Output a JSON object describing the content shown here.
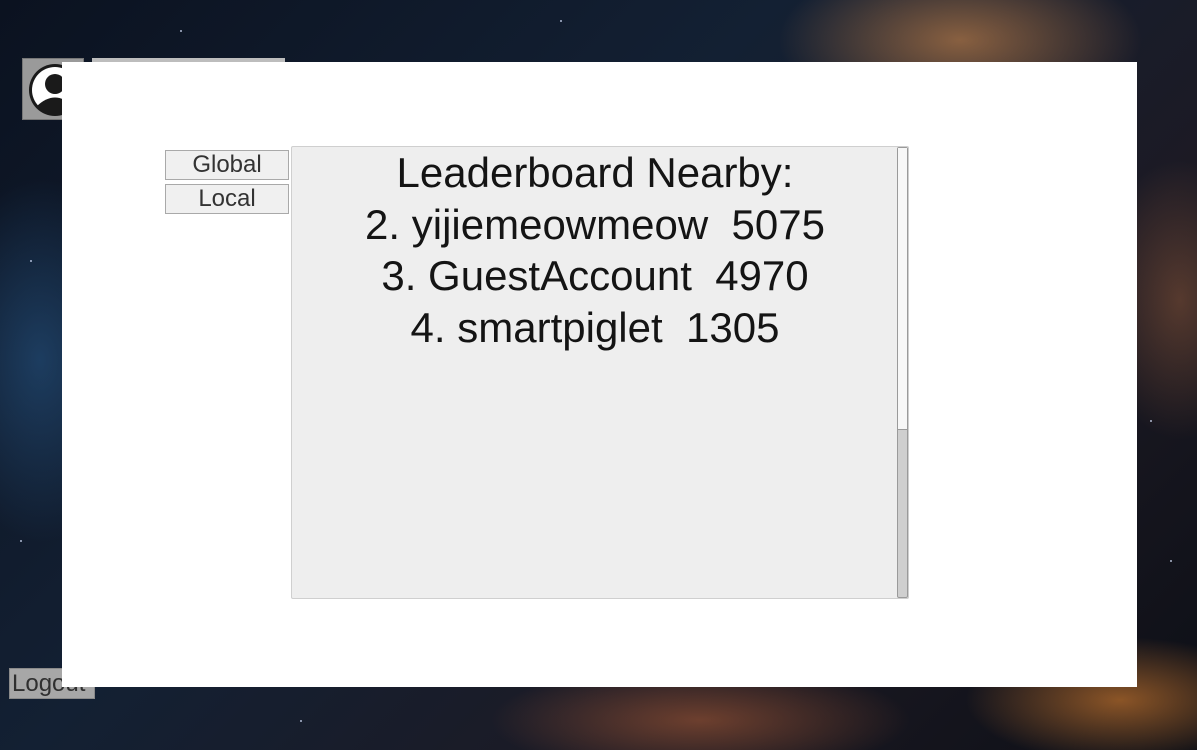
{
  "user": {
    "avatar_icon": "user-avatar-icon",
    "logout_label": "Logout"
  },
  "leaderboard": {
    "tabs": [
      {
        "label": "Global"
      },
      {
        "label": "Local"
      }
    ],
    "title": "Leaderboard Nearby:",
    "entries": [
      {
        "rank": "2.",
        "name": "yijiemeowmeow",
        "score": "5075"
      },
      {
        "rank": "3.",
        "name": "GuestAccount",
        "score": "4970"
      },
      {
        "rank": "4.",
        "name": "smartpiglet",
        "score": "1305"
      }
    ],
    "scroll_position": 0
  },
  "colors": {
    "modal_background": "#ffffff",
    "board_background": "#eeeeee",
    "text": "#141414"
  }
}
